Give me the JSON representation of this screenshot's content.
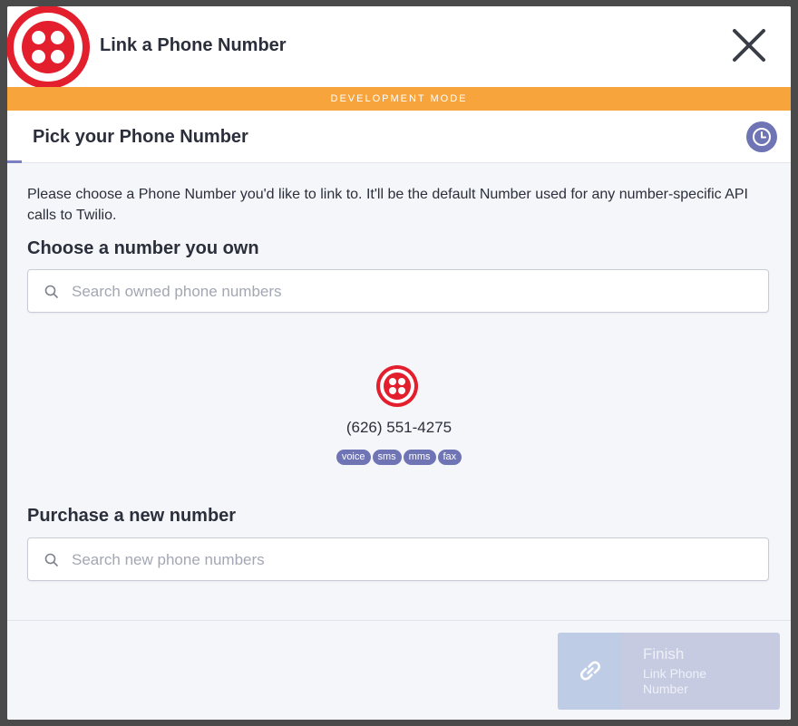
{
  "header": {
    "title": "Link a Phone Number",
    "logo_icon": "twilio-logo-icon",
    "close_icon": "close-icon"
  },
  "dev_banner": {
    "label": "DEVELOPMENT MODE"
  },
  "step": {
    "title": "Pick your Phone Number",
    "history_icon": "clock-icon"
  },
  "description": "Please choose a Phone Number you'd like to link to. It'll be the default Number used for any number-specific API calls to Twilio.",
  "owned": {
    "label": "Choose a number you own",
    "search_placeholder": "Search owned phone numbers",
    "search_value": "",
    "numbers": [
      {
        "number": "(626) 551-4275",
        "capabilities": [
          "voice",
          "sms",
          "mms",
          "fax"
        ]
      }
    ]
  },
  "purchase": {
    "label": "Purchase a new number",
    "search_placeholder": "Search new phone numbers",
    "search_value": ""
  },
  "footer": {
    "finish_label": "Finish",
    "finish_sublabel": "Link Phone Number",
    "finish_icon": "link-icon"
  },
  "colors": {
    "brand_red": "#e31e2d",
    "dev_orange": "#f7a43d",
    "accent_purple": "#6f74b4"
  }
}
